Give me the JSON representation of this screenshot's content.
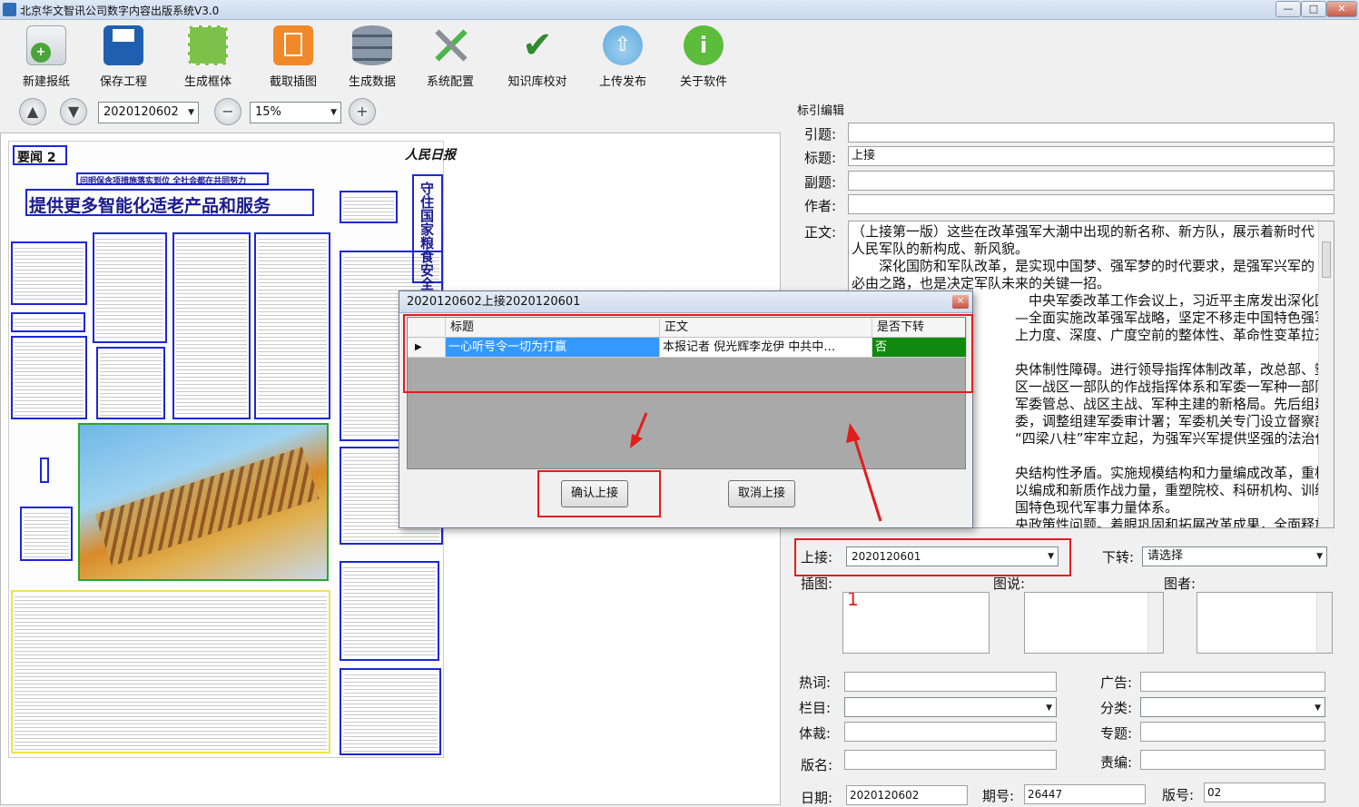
{
  "window": {
    "title": "北京华文智讯公司数字内容出版系统V3.0"
  },
  "toolbar": {
    "buttons": [
      {
        "label": "新建报纸",
        "icon": "new-paper-icon",
        "color": "#4aa43a"
      },
      {
        "label": "保存工程",
        "icon": "save-disk-icon",
        "color": "#1f5fb0"
      },
      {
        "label": "生成框体",
        "icon": "generate-frame-icon",
        "color": "#7cc24a"
      },
      {
        "label": "截取插图",
        "icon": "crop-image-icon",
        "color": "#f0892a"
      },
      {
        "label": "生成数据",
        "icon": "database-icon",
        "color": "#6c7b8c"
      },
      {
        "label": "系统配置",
        "icon": "tools-icon",
        "color": "#4bb54b"
      },
      {
        "label": "知识库校对",
        "icon": "checkmark-icon",
        "color": "#2e8b2e"
      },
      {
        "label": "上传发布",
        "icon": "cloud-upload-icon",
        "color": "#5aa6dc"
      },
      {
        "label": "关于软件",
        "icon": "info-key-icon",
        "color": "#5cbc3c"
      }
    ]
  },
  "nav": {
    "date_value": "2020120602",
    "zoom_value": "15%"
  },
  "newspaper": {
    "page_label": "要闻 2",
    "masthead": "人民日报",
    "headline": "提供更多智能化适老产品和服务",
    "subhead": "问明保含项措施落实到位 全社会都在共同努力",
    "side_heading": "守住国家粮食安全"
  },
  "panel": {
    "group_title": "标引编辑",
    "labels": {
      "intro": "引题:",
      "title": "标题:",
      "subtitle": "副题:",
      "author": "作者:",
      "body": "正文:",
      "upper": "上接:",
      "lower": "下转:",
      "illustration": "插图:",
      "caption": "图说:",
      "photographer": "图者:",
      "hotword": "热词:",
      "ad": "广告:",
      "column": "栏目:",
      "category": "分类:",
      "genre": "体裁:",
      "topic": "专题:",
      "edition_name": "版名:",
      "editor": "责编:",
      "date": "日期:",
      "issue": "期号:",
      "page_no": "版号:"
    },
    "values": {
      "intro": "",
      "title": "上接",
      "subtitle": "",
      "author": "",
      "upper": "2020120601",
      "lower": "请选择",
      "illustration_count": "1",
      "date": "2020120602",
      "issue": "26447",
      "page_no": "02"
    },
    "body_lines": [
      "（上接第一版）这些在改革强军大潮中出现的新名称、新方队，展示着新时代",
      "人民军队的新构成、新风貌。",
      "　　深化国防和军队改革，是实现中国梦、强军梦的时代要求，是强军兴军的",
      "必由之路，也是决定军队未来的关键一招。",
      "　　　　　　　　　　　　　中央军委改革工作会议上，习近平主席发出深化国防和",
      "　　　　　　　　　　　　—全面实施改革强军战略，坚定不移走中国特色强军之",
      "　　　　　　　　　　　　上力度、深度、广度空前的整体性、革命性变革拉开大",
      "",
      "　　　　　　　　　　　　央体制性障碍。进行领导指挥体制改革，改总部、塑军",
      "　　　　　　　　　　　　区一战区一部队的作战指挥体系和军委一军种一部队的",
      "　　　　　　　　　　　　军委管总、战区主战、军种主建的新格局。先后组建新的",
      "　　　　　　　　　　　　委，调整组建军委审计署；军委机关专门设立督察部门",
      "　　　　　　　　　　　　“四梁八柱”牢牢立起，为强军兴军提供坚强的法治保",
      "",
      "　　　　　　　　　　　　央结构性矛盾。实施规模结构和力量编成改革，重构规模",
      "　　　　　　　　　　　　以编成和新质作战力量，重塑院校、科研机构、训练机构",
      "　　　　　　　　　　　　国特色现代军事力量体系。",
      "　　　　　　　　　　　　央政策性问题。着眼巩固和拓展改革成果，全面释放改革"
    ]
  },
  "dialog": {
    "title": "2020120602上接2020120601",
    "close": "×",
    "columns": [
      "标题",
      "正文",
      "是否下转"
    ],
    "rows": [
      {
        "title": "一心听号令一切为打赢",
        "body": "本报记者  倪光辉李龙伊        中共中…",
        "turn": "否"
      }
    ],
    "confirm": "确认上接",
    "cancel": "取消上接"
  },
  "colors": {
    "accent_blue": "#3399ff",
    "status_green": "#0f8a0f",
    "annotation_red": "#e31c1c",
    "frame_blue": "#1d27d6"
  }
}
